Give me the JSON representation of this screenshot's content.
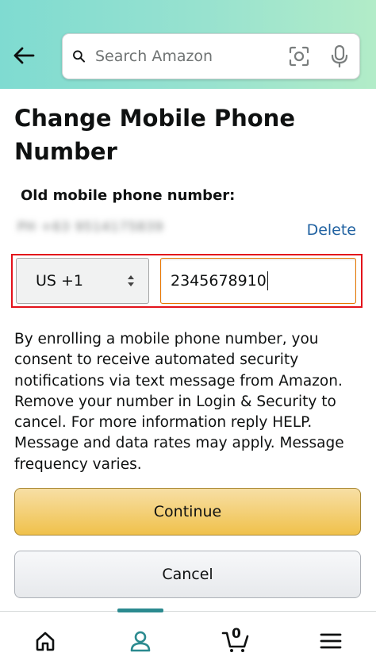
{
  "header": {
    "search": {
      "placeholder": "Search Amazon"
    },
    "back_icon": "arrow-left-icon",
    "camera_icon": "camera-scan-icon",
    "mic_icon": "microphone-icon"
  },
  "page": {
    "title": "Change Mobile Phone Number",
    "old_number_label": "Old mobile phone number:",
    "old_number_value": "PH +63 9514175839",
    "delete_label": "Delete"
  },
  "phone": {
    "country_code": "US +1",
    "number_value": "2345678910"
  },
  "consent_text": "By enrolling a mobile phone number, you consent to receive automated security notifications via text message from Amazon. Remove your number in Login & Security to cancel. For more information reply HELP. Message and data rates may apply. Message frequency varies.",
  "buttons": {
    "continue_label": "Continue",
    "cancel_label": "Cancel"
  },
  "bottom_nav": {
    "items": [
      "home-icon",
      "account-icon",
      "cart-icon",
      "menu-icon"
    ],
    "active": "account-icon",
    "cart_count": "0"
  },
  "colors": {
    "accent_teal": "#2b8a8f",
    "link_blue": "#2162a1",
    "highlight_red": "#e3121b",
    "continue_yellow": "#f0c14b"
  }
}
